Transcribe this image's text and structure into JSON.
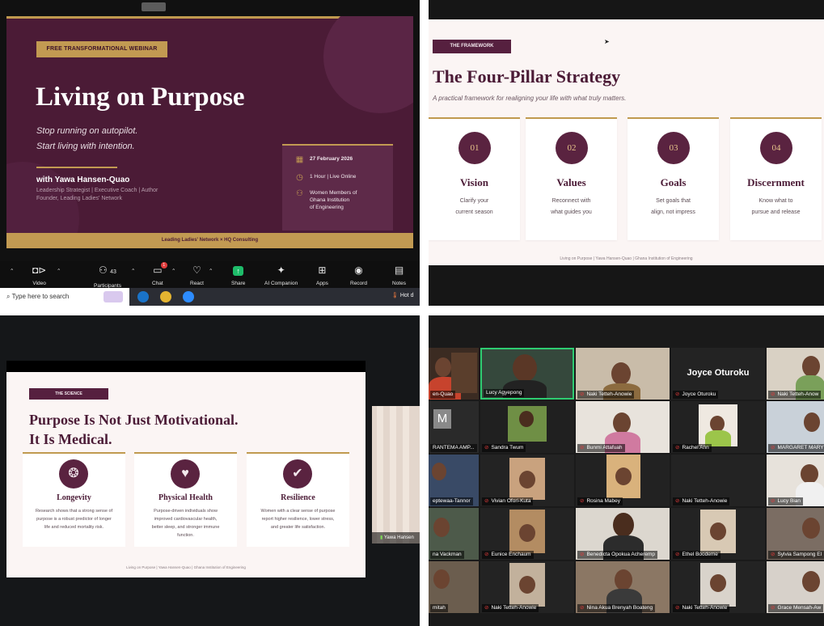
{
  "q1": {
    "slide": {
      "tag": "FREE TRANSFORMATIONAL WEBINAR",
      "title": "Living on Purpose",
      "subtitle_line1": "Stop running on autopilot.",
      "subtitle_line2": "Start living with intention.",
      "presenter": "with Yawa Hansen-Quao",
      "role_line1": "Leadership Strategist  |  Executive Coach  |  Author",
      "role_line2": "Founder, Leading Ladies' Network",
      "date": "27 February 2026",
      "duration": "1 Hour  |  Live Online",
      "audience_line1": "Women Members of",
      "audience_line2": "Ghana Institution",
      "audience_line3": "of Engineering",
      "footer": "Leading Ladies' Network  ×  HQ Consulting"
    },
    "toolbar": {
      "video": "Video",
      "participants": "Participants",
      "participants_count": "43",
      "chat": "Chat",
      "chat_badge": "1",
      "react": "React",
      "share": "Share",
      "ai": "AI Companion",
      "apps": "Apps",
      "record": "Record",
      "notes": "Notes"
    },
    "taskbar": {
      "search_placeholder": "Type here to search",
      "weather": "Hot d"
    }
  },
  "q2": {
    "tag": "THE FRAMEWORK",
    "title": "The Four-Pillar Strategy",
    "lead": "A practical framework for realigning your life with what truly matters.",
    "pillars": [
      {
        "num": "01",
        "title": "Vision",
        "line1": "Clarify your",
        "line2": "current season"
      },
      {
        "num": "02",
        "title": "Values",
        "line1": "Reconnect with",
        "line2": "what guides you"
      },
      {
        "num": "03",
        "title": "Goals",
        "line1": "Set goals that",
        "line2": "align, not impress"
      },
      {
        "num": "04",
        "title": "Discernment",
        "line1": "Know what to",
        "line2": "pursue and release"
      }
    ],
    "footer": "Living on Purpose  |  Yawa Hansen-Quao  |  Ghana Institution of Engineering"
  },
  "q3": {
    "tag": "THE SCIENCE",
    "title_line1": "Purpose Is Not Just Motivational.",
    "title_line2": "It Is Medical.",
    "cards": [
      {
        "title": "Longevity",
        "l1": "Research shows that a strong sense of",
        "l2": "purpose is a robust predictor of longer",
        "l3": "life and reduced mortality risk.",
        "l4": ""
      },
      {
        "title": "Physical Health",
        "l1": "Purpose-driven individuals show",
        "l2": "improved cardiovascular health,",
        "l3": "better sleep, and stronger immune",
        "l4": "function."
      },
      {
        "title": "Resilience",
        "l1": "Women with a clear sense of purpose",
        "l2": "report higher resilience, lower stress,",
        "l3": "and greater life satisfaction.",
        "l4": ""
      }
    ],
    "footer": "Living on Purpose  |  Yawa Hansen-Quao  |  Ghana Institution of Engineering",
    "pip_name": "Yawa Hansen"
  },
  "q4": {
    "speaker": "Joyce Oturoku",
    "tiles": [
      "en-Quao",
      "Lucy Agyepong",
      "Naki Tetteh-Anowie",
      "Joyce Oturoku",
      "Naki Tetteh-Anow",
      "RANTEMA AMP...",
      "Sandra Twum",
      "Bunmi Attafuah",
      "Rachel Ann",
      "MARGARET MARY",
      "eptewaa-Tannor",
      "Vivian Ofori-Kuta",
      "Rosina Mabey",
      "Naki Tetteh-Anowie",
      "Lucy Bian",
      "na Vackman",
      "Eunice Enchaum",
      "Benedicta Opokua Acheremp",
      "Ethel Boodeme",
      "Sylvia Sampong El",
      "mitah",
      "Naki Tetteh-Anowie",
      "Nina Akua Brenyah Boateng",
      "Naki Tetteh-Anowie",
      "Grace Mensah-Aw"
    ]
  }
}
